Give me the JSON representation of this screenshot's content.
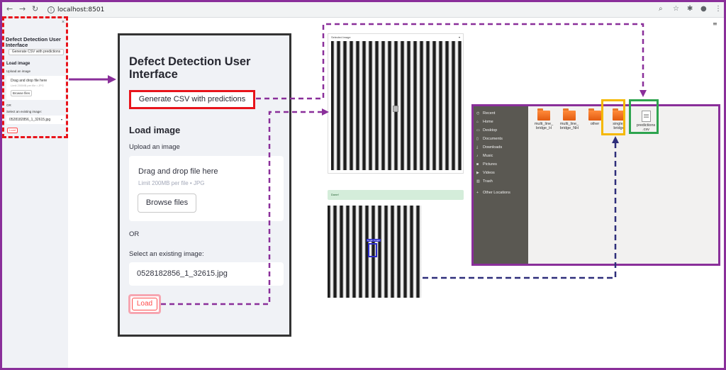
{
  "browser": {
    "back_icon": "back-arrow-icon",
    "forward_icon": "forward-arrow-icon",
    "reload_icon": "reload-icon",
    "url": "localhost:8501"
  },
  "app": {
    "title": "Defect Detection User Interface",
    "generate_button": "Generate CSV with predictions",
    "load_image_heading": "Load image",
    "upload_label": "Upload an image",
    "drop_text": "Drag and drop file here",
    "drop_limit": "Limit 200MB per file • JPG",
    "browse_button": "Browse files",
    "or_text": "OR",
    "select_label": "Select an existing image:",
    "selected_image": "0528182856_1_32615.jpg",
    "load_button": "Load"
  },
  "results": {
    "selected_image_header": "Selected image",
    "done_text": "Done!",
    "bbox_label": "single_bridge"
  },
  "file_manager": {
    "places": [
      {
        "icon": "clock-icon",
        "label": "Recent"
      },
      {
        "icon": "home-icon",
        "label": "Home"
      },
      {
        "icon": "folder-icon",
        "label": "Desktop"
      },
      {
        "icon": "document-icon",
        "label": "Documents"
      },
      {
        "icon": "download-icon",
        "label": "Downloads"
      },
      {
        "icon": "music-icon",
        "label": "Music"
      },
      {
        "icon": "camera-icon",
        "label": "Pictures"
      },
      {
        "icon": "video-icon",
        "label": "Videos"
      },
      {
        "icon": "trash-icon",
        "label": "Trash"
      },
      {
        "icon": "plus-icon",
        "label": "Other Locations"
      }
    ],
    "files": [
      {
        "name1": "multi_line_",
        "name2": "bridge_H"
      },
      {
        "name1": "multi_line_",
        "name2": "bridge_NH"
      },
      {
        "name1": "other",
        "name2": ""
      },
      {
        "name1": "single_",
        "name2": "bridge"
      },
      {
        "name1": "predictions",
        "name2": ".csv"
      }
    ]
  },
  "colors": {
    "annotation_purple": "#8a2f9a",
    "highlight_red": "#e8141b",
    "highlight_orange": "#f5b800",
    "highlight_green": "#2ea44f",
    "arrow_navy": "#2e2e7a",
    "streamlit_red": "#ff4b4b"
  }
}
